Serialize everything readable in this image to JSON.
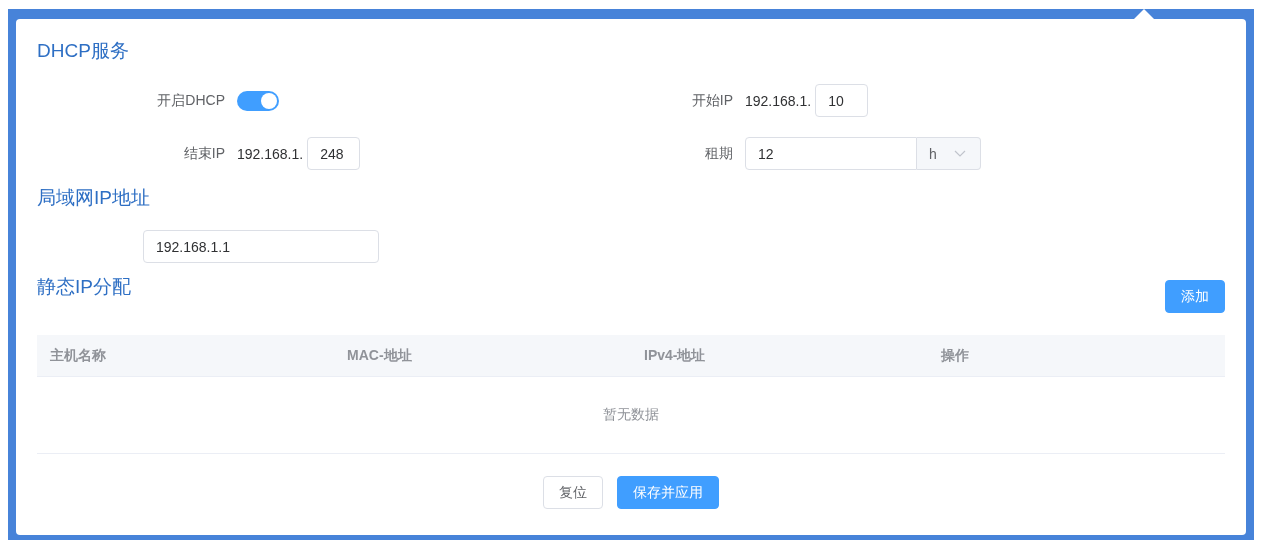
{
  "dhcp": {
    "title": "DHCP服务",
    "enable": {
      "label": "开启DHCP",
      "on": true
    },
    "start_ip": {
      "label": "开始IP",
      "prefix": "192.168.1.",
      "value": "10"
    },
    "end_ip": {
      "label": "结束IP",
      "prefix": "192.168.1.",
      "value": "248"
    },
    "lease": {
      "label": "租期",
      "value": "12",
      "unit": "h"
    }
  },
  "lan": {
    "title": "局域网IP地址",
    "value": "192.168.1.1"
  },
  "static": {
    "title": "静态IP分配",
    "add_button": "添加",
    "table": {
      "columns": [
        "主机名称",
        "MAC-地址",
        "IPv4-地址",
        "操作"
      ],
      "empty_text": "暂无数据"
    }
  },
  "buttons": [
    {
      "label": "复位",
      "kind": "default"
    },
    {
      "label": "保存并应用",
      "kind": "primary"
    }
  ]
}
